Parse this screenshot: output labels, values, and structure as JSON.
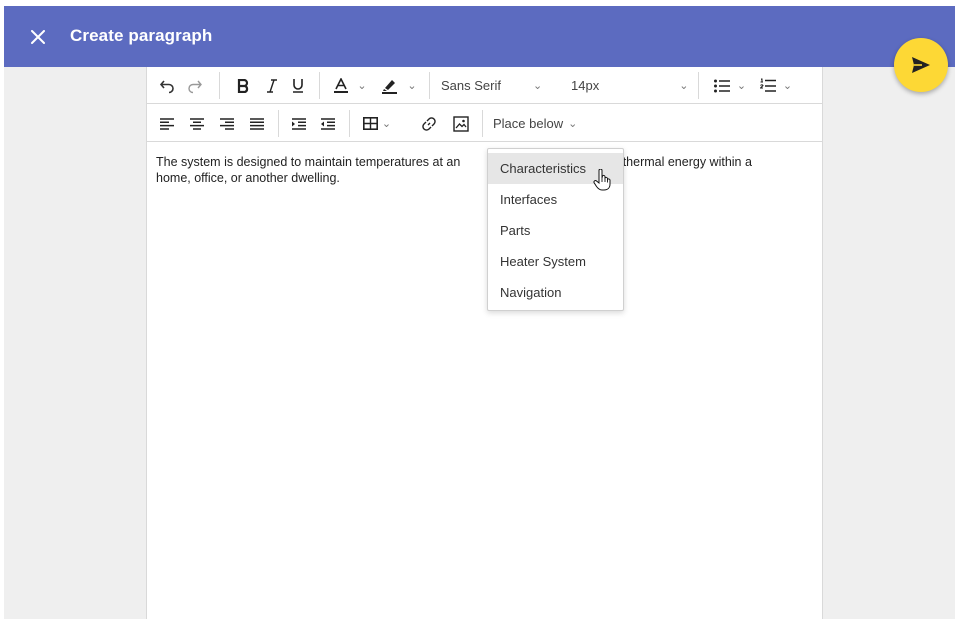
{
  "header": {
    "title": "Create paragraph",
    "close_icon": "close-icon",
    "background": "#5c6bc0"
  },
  "fab": {
    "icon": "send-icon",
    "color": "#fdd835"
  },
  "toolbar": {
    "font_family": "Sans Serif",
    "font_size": "14px",
    "place_below_label": "Place below"
  },
  "content": {
    "text_before": "The system is designed to maintain temperatures at an",
    "text_after": "ng thermal energy within a",
    "line2": "home, office, or another dwelling."
  },
  "dropdown": {
    "items": [
      {
        "label": "Characteristics",
        "active": true
      },
      {
        "label": "Interfaces"
      },
      {
        "label": "Parts"
      },
      {
        "label": "Heater System"
      },
      {
        "label": "Navigation"
      }
    ]
  }
}
